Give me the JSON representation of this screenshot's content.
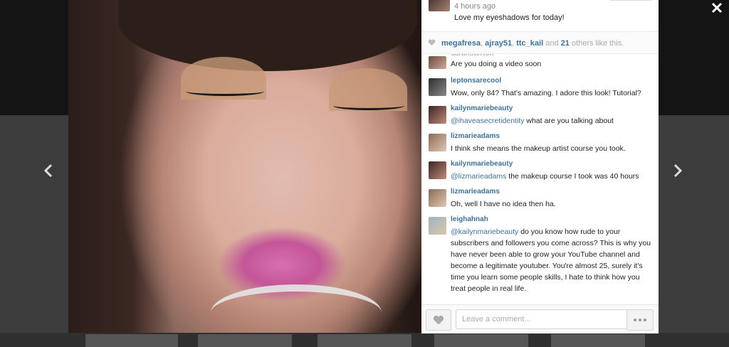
{
  "caption": {
    "time": "4 hours ago",
    "text": "Love my eyeshadows for today!"
  },
  "likes": {
    "users": [
      "megafresa",
      "ajray51",
      "ttc_kail"
    ],
    "sep": ", ",
    "and": " and ",
    "count": "21",
    "suffix": " others like this."
  },
  "comments": {
    "first": {
      "user": "sarahsterton",
      "text": "Are you doing a video soon"
    },
    "items": [
      {
        "user": "leptonsarecool",
        "mention": "",
        "text": "Wow, only 84? That's amazing. I adore this look! Tutorial?"
      },
      {
        "user": "kailynmariebeauty",
        "mention": "@ihaveasecretidentity",
        "text": " what are you talking about"
      },
      {
        "user": "lizmarieadams",
        "mention": "",
        "text": "I think she means the makeup artist course you took."
      },
      {
        "user": "kailynmariebeauty",
        "mention": "@lizmarieadams",
        "text": " the makeup course I took was 40 hours"
      },
      {
        "user": "lizmarieadams",
        "mention": "",
        "text": "Oh, well I have no idea then ha."
      },
      {
        "user": "leighahnah",
        "mention": "@kailynmariebeauty",
        "text": " do you know how rude to your subscribers and followers you come across? This is why you have never been able to grow your YouTube channel and become a legitimate youtuber. You're almost 25, surely it's time you learn some people skills, I hate to think how you treat people in real life."
      }
    ]
  },
  "input": {
    "placeholder": "Leave a comment..."
  },
  "icons": {
    "close": "close-icon",
    "prev": "chevron-left-icon",
    "next": "chevron-right-icon",
    "heart": "heart-icon",
    "more": "more-icon"
  },
  "colors": {
    "link": "#3f729b",
    "text": "#222222",
    "muted": "#aaaaaa"
  }
}
